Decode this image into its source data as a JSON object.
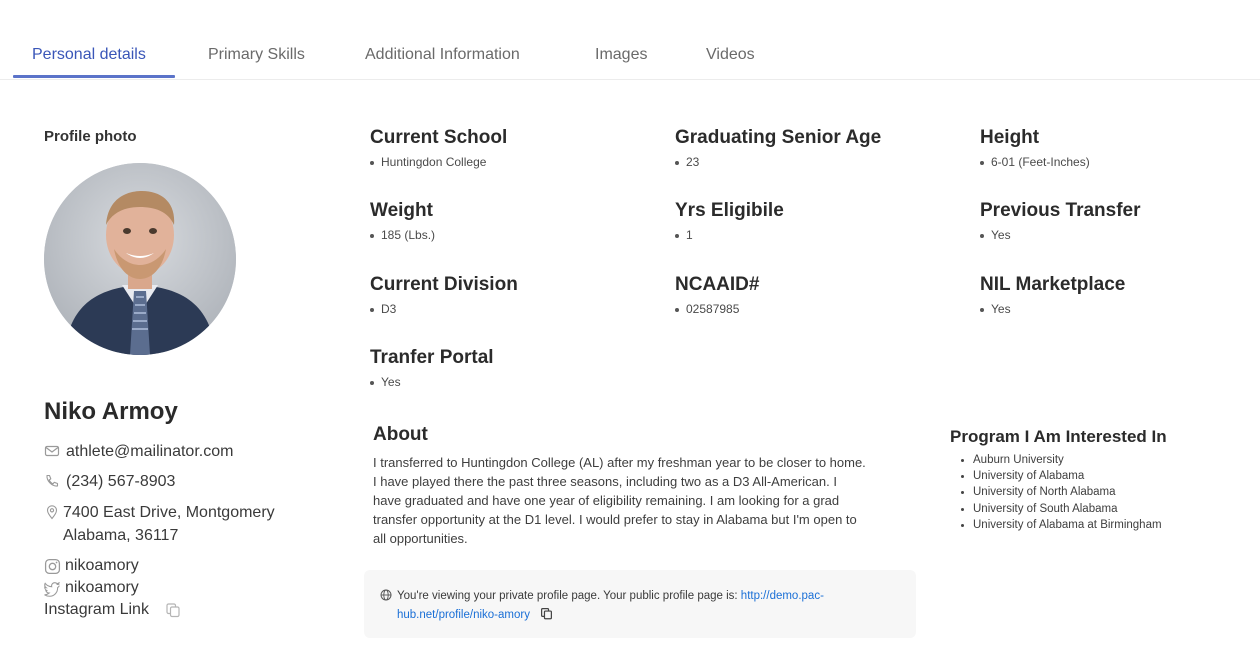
{
  "tabs": [
    {
      "label": "Personal details",
      "active": true
    },
    {
      "label": "Primary Skills",
      "active": false
    },
    {
      "label": "Additional Information",
      "active": false
    },
    {
      "label": "Images",
      "active": false
    },
    {
      "label": "Videos",
      "active": false
    }
  ],
  "profile": {
    "photo_label": "Profile photo",
    "name": "Niko Armoy",
    "email": "athlete@mailinator.com",
    "phone": "(234) 567-8903",
    "address_line1": "7400 East Drive, Montgomery",
    "address_line2": "Alabama, 36117",
    "instagram": "nikoamory",
    "twitter": "nikoamory",
    "instagram_link_label": "Instagram Link"
  },
  "fields": [
    {
      "label": "Current School",
      "value": "Huntingdon College"
    },
    {
      "label": "Graduating Senior Age",
      "value": "23"
    },
    {
      "label": "Height",
      "value": "6-01 (Feet-Inches)"
    },
    {
      "label": "Weight",
      "value": "185 (Lbs.)"
    },
    {
      "label": "Yrs Eligibile",
      "value": "1"
    },
    {
      "label": "Previous Transfer",
      "value": "Yes"
    },
    {
      "label": "Current Division",
      "value": "D3"
    },
    {
      "label": "NCAAID#",
      "value": "02587985"
    },
    {
      "label": "NIL Marketplace",
      "value": "Yes"
    },
    {
      "label": "Tranfer Portal",
      "value": "Yes"
    }
  ],
  "about": {
    "title": "About",
    "text": "I transferred to Huntingdon College (AL) after my freshman year to be closer to home. I have played there the past three seasons, including two as a D3 All-American. I have graduated and have one year of eligibility remaining. I am looking for a grad transfer opportunity at the D1 level. I would prefer to stay in Alabama but I'm open to all opportunities."
  },
  "programs": {
    "title": "Program I Am Interested In",
    "items": [
      "Auburn University",
      "University of Alabama",
      "University of North Alabama",
      "University of South Alabama",
      "University of Alabama at Birmingham"
    ]
  },
  "notice": {
    "text": "You're viewing your private profile page. Your public profile page is: ",
    "link": "http://demo.pac-hub.net/profile/niko-amory"
  },
  "colors": {
    "accent": "#3a56b8",
    "link": "#1a6fd6"
  }
}
